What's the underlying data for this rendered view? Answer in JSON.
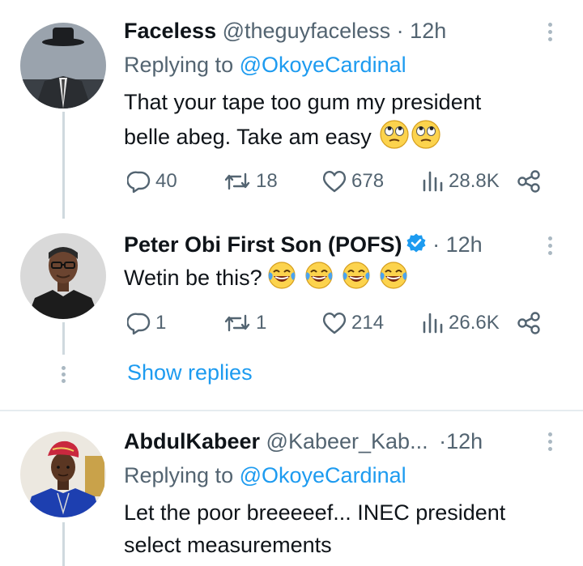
{
  "tweets": [
    {
      "name": "Faceless",
      "handle": "@theguyfaceless",
      "separator": "·",
      "time": "12h",
      "replying_prefix": "Replying to",
      "replying_to": "@OkoyeCardinal",
      "text_line1": "That your tape too gum my president",
      "text_line2": "belle abeg. Take am easy",
      "emojis": [
        "face-with-rolling-eyes",
        "face-with-rolling-eyes"
      ],
      "replies": "40",
      "retweets": "18",
      "likes": "678",
      "views": "28.8K"
    },
    {
      "name": "Peter Obi First Son (POFS)",
      "verified": true,
      "separator": "·",
      "time": "12h",
      "text_line1": "Wetin be this?",
      "emojis": [
        "face-with-tears-of-joy",
        "face-with-tears-of-joy",
        "face-with-tears-of-joy",
        "face-with-tears-of-joy"
      ],
      "replies": "1",
      "retweets": "1",
      "likes": "214",
      "views": "26.6K"
    },
    {
      "name": "AbdulKabeer",
      "handle": "@Kabeer_Kab...",
      "separator": "·",
      "time": "12h",
      "replying_prefix": "Replying to",
      "replying_to": "@OkoyeCardinal",
      "text_line1": "Let the poor breeeeef... INEC president",
      "text_line2": "select measurements"
    }
  ],
  "show_replies": "Show replies",
  "colors": {
    "accent": "#1d9bf0",
    "secondary_text": "#536471",
    "verified": "#1d9bf0"
  }
}
